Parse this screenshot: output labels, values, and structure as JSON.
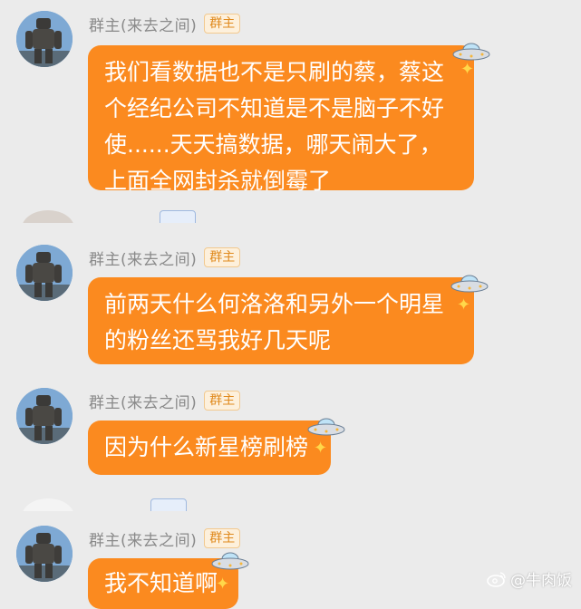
{
  "sender": {
    "name": "群主(来去之间)",
    "badge": "群主"
  },
  "messages": [
    {
      "text": "我们看数据也不是只刷的蔡，蔡这个经纪公司不知道是不是脑子不好使......天天搞数据，哪天闹大了，上面全网封杀就倒霉了"
    },
    {
      "text": "前两天什么何洛洛和另外一个明星的粉丝还骂我好几天呢"
    },
    {
      "text": "因为什么新星榜刷榜"
    },
    {
      "text": "我不知道啊"
    }
  ],
  "watermark": {
    "text": "@牛肉饭",
    "icon": "weibo-icon"
  },
  "colors": {
    "bubble": "#fb8a1f",
    "background": "#ebebeb",
    "badge_text": "#e08a1e"
  }
}
